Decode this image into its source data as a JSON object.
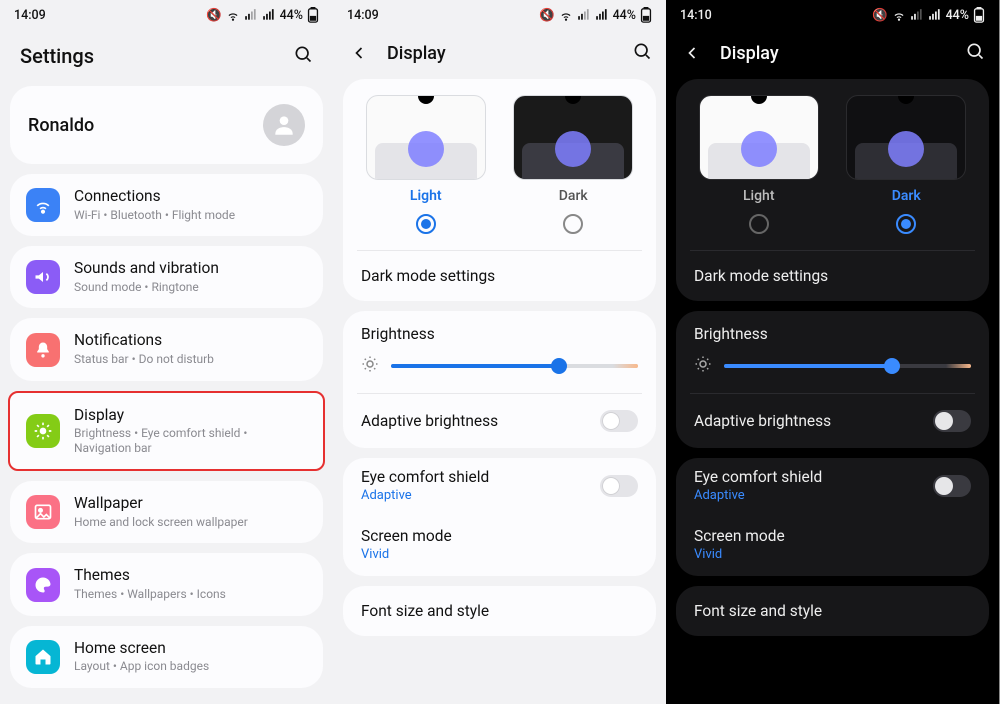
{
  "status": {
    "time1": "14:09",
    "time2": "14:09",
    "time3": "14:10",
    "battery_pct": "44%"
  },
  "p1": {
    "title": "Settings",
    "profile_name": "Ronaldo",
    "items": [
      {
        "title": "Connections",
        "sub": "Wi-Fi  •  Bluetooth  •  Flight mode",
        "color": "#3b82f6",
        "icon": "wifi"
      },
      {
        "title": "Sounds and vibration",
        "sub": "Sound mode  •  Ringtone",
        "color": "#8b5cf6",
        "icon": "sound"
      },
      {
        "title": "Notifications",
        "sub": "Status bar  •  Do not disturb",
        "color": "#f87171",
        "icon": "bell"
      },
      {
        "title": "Display",
        "sub": "Brightness  •  Eye comfort shield  •  Navigation bar",
        "color": "#84cc16",
        "icon": "sun",
        "highlight": true
      },
      {
        "title": "Wallpaper",
        "sub": "Home and lock screen wallpaper",
        "color": "#fb7185",
        "icon": "image"
      },
      {
        "title": "Themes",
        "sub": "Themes  •  Wallpapers  •  Icons",
        "color": "#a855f7",
        "icon": "palette"
      },
      {
        "title": "Home screen",
        "sub": "Layout  •  App icon badges",
        "color": "#06b6d4",
        "icon": "home"
      }
    ]
  },
  "display": {
    "title": "Display",
    "light_label": "Light",
    "dark_label": "Dark",
    "dark_mode_settings": "Dark mode settings",
    "brightness": "Brightness",
    "adaptive_brightness": "Adaptive brightness",
    "eye_comfort": "Eye comfort shield",
    "eye_comfort_sub": "Adaptive",
    "screen_mode": "Screen mode",
    "screen_mode_sub": "Vivid",
    "font_size": "Font size and style"
  }
}
